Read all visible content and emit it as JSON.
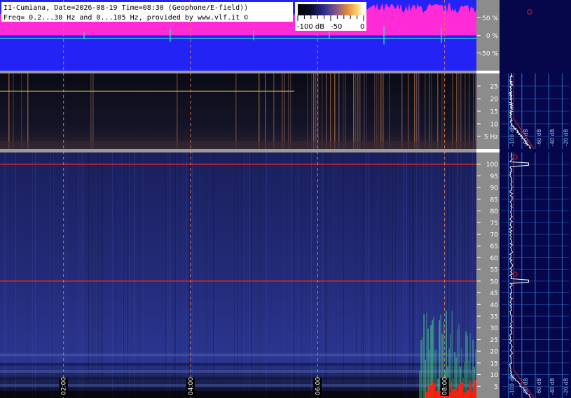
{
  "header": {
    "line1": "I1-Cumiana, Date=2026-08-19 Time=08:30 (Geophone/E-field))",
    "line2": "Freq= 0.2...30 Hz and 0...105 Hz, provided by www.vlf.it ©"
  },
  "colorbar": {
    "tick_labels": [
      "-100 dB",
      "-50",
      "0"
    ],
    "range_db": [
      -100,
      0
    ]
  },
  "colors": {
    "waveform_background": "#2323f5",
    "waveform_envelope": "#ff2bd6",
    "waveform_trace": "#33e0d0",
    "low_spectrogram_background": "#0b0b14",
    "high_spectrogram_background": "#1b2060",
    "axis_panel": "#8c8c8c",
    "spectrum_panel": "#06064a",
    "spectrum_grid": "#2b6cc4",
    "spectrum_trace": "#ffffff",
    "spectrum_reference": "#e02020",
    "time_marker": "#ff8a3d"
  },
  "chart_data": [
    {
      "type": "line",
      "name": "waveform",
      "ylim": [
        -100,
        100
      ],
      "y_tick_labels": [
        "50 %",
        "0 %",
        "-50 %"
      ],
      "y_ticks": [
        50,
        0,
        -50
      ]
    },
    {
      "type": "heatmap",
      "name": "low-frequency-spectrogram",
      "ylim": [
        0,
        30
      ],
      "y_tick_labels": [
        "25",
        "20",
        "15",
        "10",
        "5 Hz"
      ],
      "y_ticks": [
        25,
        20,
        15,
        10,
        5
      ]
    },
    {
      "type": "heatmap",
      "name": "high-frequency-spectrogram",
      "ylim": [
        0,
        105
      ],
      "y_tick_labels": [
        "100",
        "95",
        "90",
        "85",
        "80",
        "75",
        "70",
        "65",
        "60",
        "55",
        "50",
        "45",
        "40",
        "35",
        "30",
        "25",
        "20",
        "15",
        "10",
        "5"
      ],
      "y_ticks": [
        100,
        95,
        90,
        85,
        80,
        75,
        70,
        65,
        60,
        55,
        50,
        45,
        40,
        35,
        30,
        25,
        20,
        15,
        10,
        5
      ],
      "time_labels": [
        "02:00",
        "04:00",
        "06:00",
        "08:00"
      ],
      "time_hours": [
        2,
        4,
        6,
        8
      ],
      "xlim_hours": [
        1.0,
        8.5
      ],
      "horizontal_lines_hz": [
        50,
        100
      ]
    },
    {
      "type": "line",
      "name": "low-frequency-spectrum",
      "x_tick_labels": [
        "-100 dB",
        "-80 dB",
        "-60 dB",
        "-40 dB",
        "-20 dB"
      ],
      "x_ticks_db": [
        -100,
        -80,
        -60,
        -40,
        -20
      ],
      "xlim_db": [
        -110,
        -10
      ],
      "ylim": [
        0,
        30
      ]
    },
    {
      "type": "line",
      "name": "high-frequency-spectrum",
      "x_tick_labels": [
        "-100 dB",
        "-80 dB",
        "-60 dB",
        "-40 dB",
        "-20 dB"
      ],
      "x_ticks_db": [
        -100,
        -80,
        -60,
        -40,
        -20
      ],
      "xlim_db": [
        -110,
        -10
      ],
      "ylim": [
        0,
        105
      ],
      "peak_hz": [
        50,
        100
      ]
    }
  ]
}
